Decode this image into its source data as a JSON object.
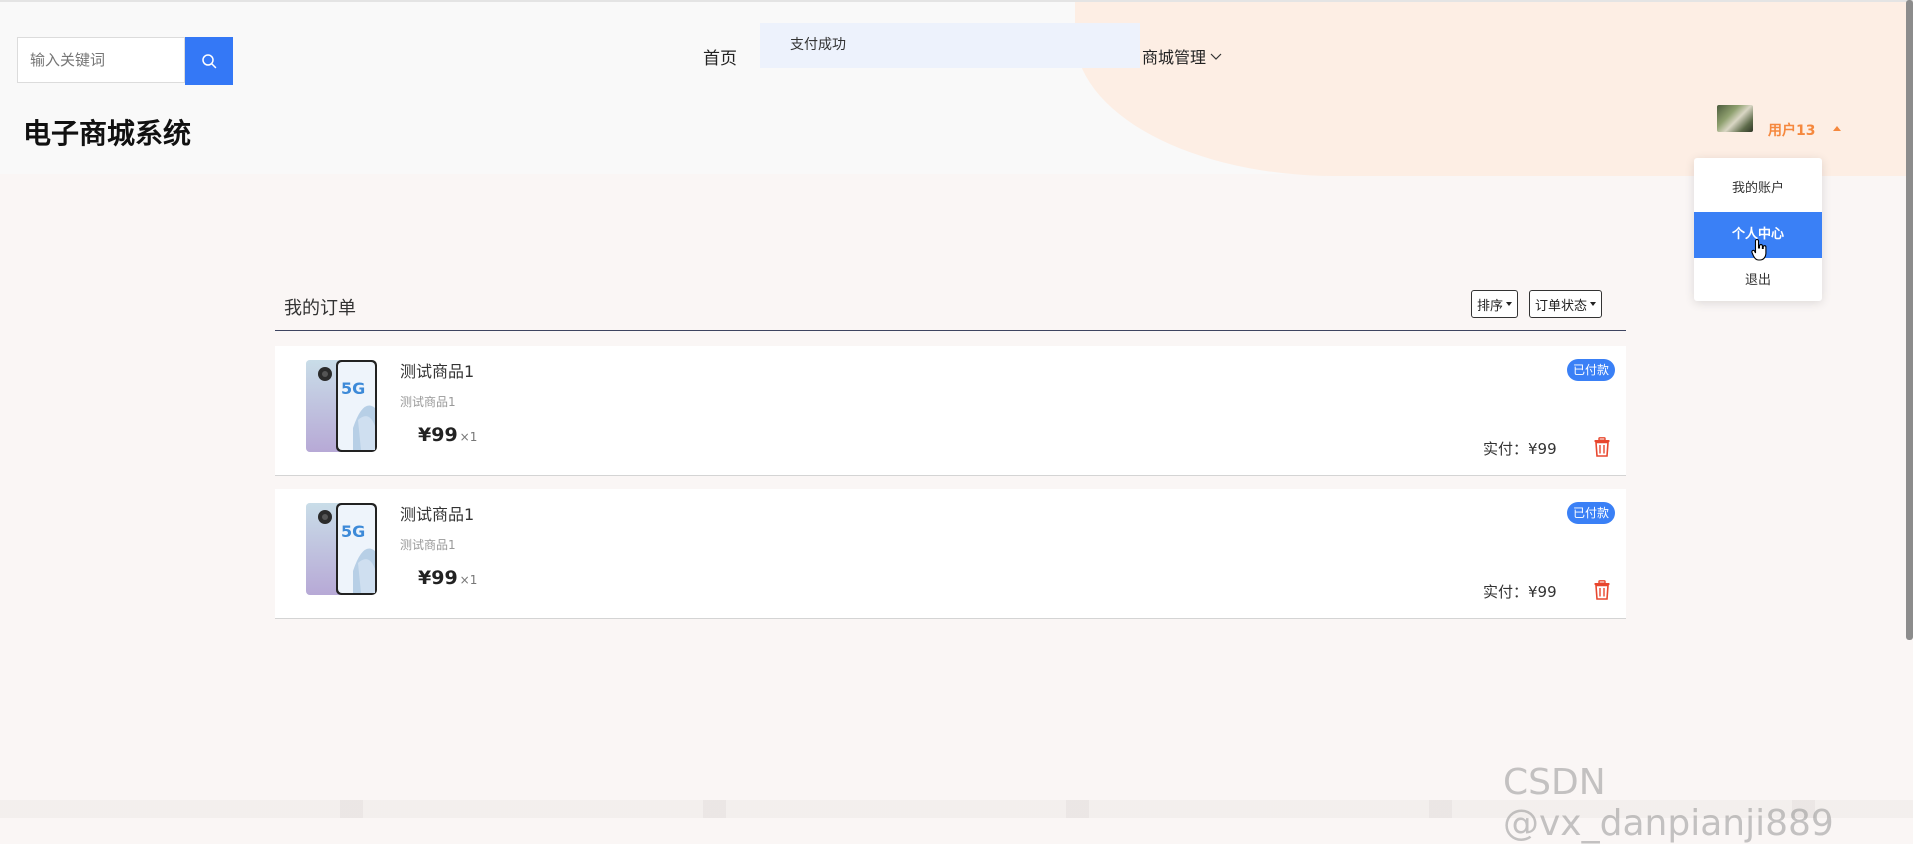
{
  "header": {
    "search_placeholder": "输入关键词",
    "site_title": "电子商城系统",
    "nav_home": "首页",
    "nav_mall": "商城管理",
    "toast_message": "支付成功",
    "username": "用户13"
  },
  "user_menu": {
    "items": [
      "我的账户",
      "个人中心",
      "退出"
    ],
    "active_index": 1
  },
  "orders": {
    "title": "我的订单",
    "sort_label": "排序",
    "status_filter_label": "订单状态",
    "list": [
      {
        "name": "测试商品1",
        "subtitle": "测试商品1",
        "price": "¥99",
        "qty": "×1",
        "status": "已付款",
        "paid": "实付：¥99"
      },
      {
        "name": "测试商品1",
        "subtitle": "测试商品1",
        "price": "¥99",
        "qty": "×1",
        "status": "已付款",
        "paid": "实付：¥99"
      }
    ]
  },
  "watermark": "CSDN @vx_danpianji889",
  "colors": {
    "accent_blue": "#3a80f6",
    "username_orange": "#f5883e",
    "delete_red": "#e8472e"
  }
}
